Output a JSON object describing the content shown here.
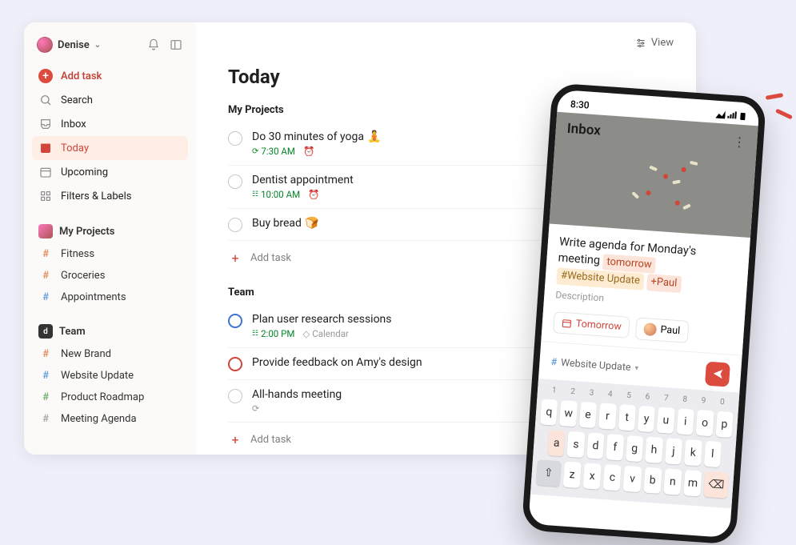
{
  "user": {
    "name": "Denise"
  },
  "sidebar": {
    "add_task": "Add task",
    "nav": {
      "search": "Search",
      "inbox": "Inbox",
      "today": "Today",
      "upcoming": "Upcoming",
      "filters": "Filters & Labels"
    },
    "my_projects": {
      "title": "My Projects",
      "items": [
        "Fitness",
        "Groceries",
        "Appointments"
      ]
    },
    "team": {
      "title": "Team",
      "badge": "d",
      "items": [
        "New Brand",
        "Website Update",
        "Product Roadmap",
        "Meeting Agenda"
      ]
    }
  },
  "topbar": {
    "view": "View"
  },
  "page": {
    "title": "Today",
    "sections": [
      {
        "title": "My Projects",
        "tasks": [
          {
            "title": "Do 30 minutes of yoga",
            "emoji": "🧘",
            "time": "7:30 AM",
            "recurring": true,
            "alarm": true
          },
          {
            "title": "Dentist appointment",
            "time": "10:00 AM",
            "calendar_icon": true,
            "alarm": true
          },
          {
            "title": "Buy bread",
            "emoji": "🍞"
          }
        ],
        "add_label": "Add task"
      },
      {
        "title": "Team",
        "tasks": [
          {
            "title": "Plan user research sessions",
            "time": "2:00 PM",
            "calendar_icon": true,
            "project": "Calendar",
            "priority": "blue"
          },
          {
            "title": "Provide feedback on Amy's design",
            "priority": "red"
          },
          {
            "title": "All-hands meeting",
            "syncing": true
          }
        ],
        "add_label": "Add task"
      }
    ]
  },
  "phone": {
    "status_time": "8:30",
    "inbox_title": "Inbox",
    "compose": {
      "text_prefix": "Write agenda for Monday's meeting",
      "token_tomorrow": "tomorrow",
      "token_project": "#Website Update",
      "token_person": "+Paul",
      "description_placeholder": "Description",
      "chip_tomorrow": "Tomorrow",
      "chip_person": "Paul",
      "project_select": "Website Update"
    },
    "keyboard": {
      "hints": [
        "1",
        "2",
        "3",
        "4",
        "5",
        "6",
        "7",
        "8",
        "9",
        "0"
      ],
      "row1": [
        "q",
        "w",
        "e",
        "r",
        "t",
        "y",
        "u",
        "i",
        "o",
        "p"
      ],
      "row2": [
        "a",
        "s",
        "d",
        "f",
        "g",
        "h",
        "j",
        "k",
        "l"
      ],
      "row3": [
        "z",
        "x",
        "c",
        "v",
        "b",
        "n",
        "m"
      ]
    }
  }
}
